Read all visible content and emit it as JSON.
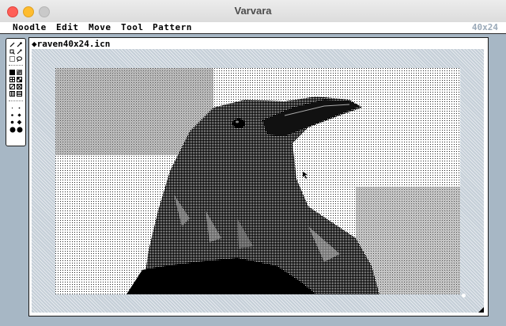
{
  "window": {
    "title": "Varvara"
  },
  "menu": {
    "items": [
      "Noodle",
      "Edit",
      "Move",
      "Tool",
      "Pattern"
    ],
    "size": "40x24"
  },
  "document": {
    "filename": "raven40x24.icn"
  },
  "toolbox": {
    "icons": [
      "pen-icon",
      "brush-icon",
      "zoom-icon",
      "magic-icon",
      "select-icon",
      "lasso-icon",
      "pattern-solid-icon",
      "pattern-dots-icon",
      "pattern-grid-icon",
      "pattern-checker-icon",
      "pattern-diag-icon",
      "pattern-cross-icon",
      "pattern-vbars-icon",
      "pattern-hbars-icon",
      "size-1-icon",
      "size-2-icon",
      "size-3-icon",
      "size-4-icon",
      "size-5-icon",
      "size-6-icon",
      "size-7-icon",
      "size-8-icon"
    ]
  }
}
